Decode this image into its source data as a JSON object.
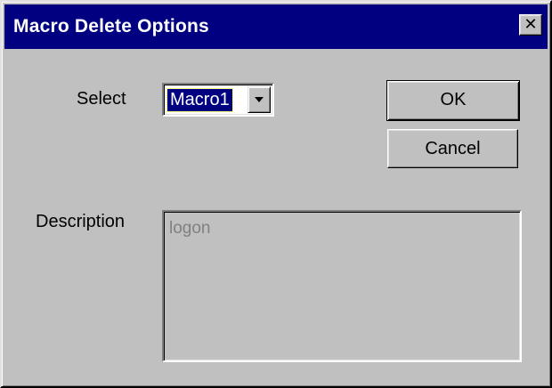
{
  "dialog": {
    "title": "Macro Delete Options",
    "close_symbol": "✕",
    "colors": {
      "title_bar": "#000080",
      "face": "#c0c0c0",
      "selection": "#000080",
      "disabled_text": "#808080"
    }
  },
  "select": {
    "label": "Select",
    "value": "Macro1",
    "arrow_icon": "chevron-down-icon"
  },
  "buttons": {
    "ok_label": "OK",
    "cancel_label": "Cancel"
  },
  "description": {
    "label": "Description",
    "value": "logon"
  }
}
